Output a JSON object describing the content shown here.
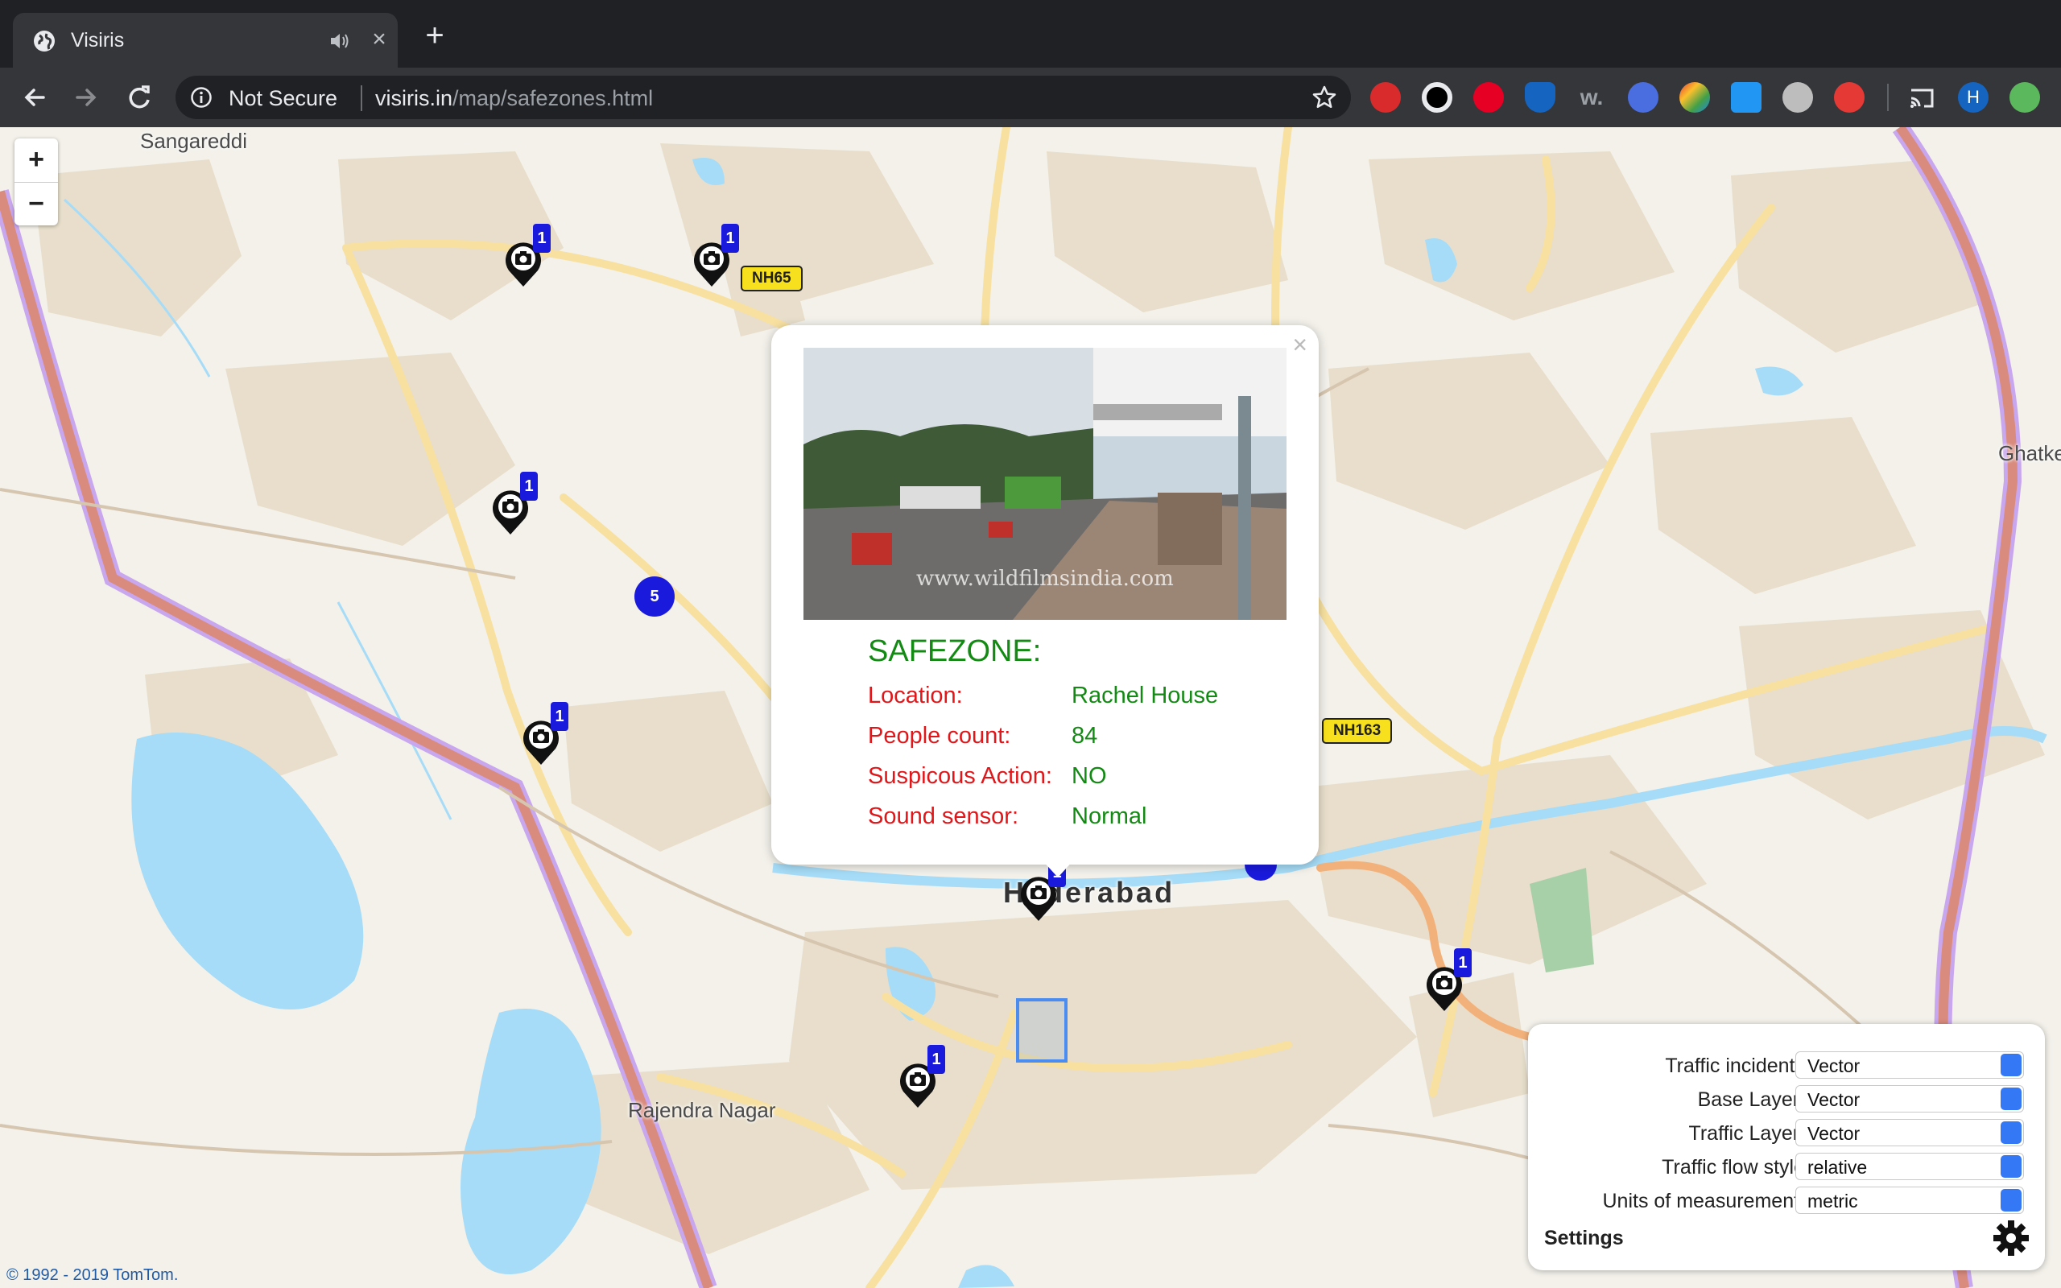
{
  "browser": {
    "tab_title": "Visiris",
    "tab_close": "×",
    "new_tab": "+",
    "security_label": "Not Secure",
    "url_host": "visiris.in",
    "url_path": "/map/safezones.html",
    "profile_initial": "H"
  },
  "map": {
    "zoom_in": "+",
    "zoom_out": "−",
    "places": {
      "sangareddi": "Sangareddi",
      "ghatkesar": "Ghatke",
      "hyderabad": "Hyderabad",
      "rajendra_nagar": "Rajendra Nagar"
    },
    "shields": {
      "nh65": "NH65",
      "nh163": "NH163"
    },
    "marker_badge": "1",
    "cluster_count": "5",
    "copyright": "© 1992 - 2019 TomTom."
  },
  "popup": {
    "close": "×",
    "watermark": "www.wildfilmsindia.com",
    "heading": "SAFEZONE:",
    "fields": [
      {
        "key": "Location:",
        "value": "Rachel House"
      },
      {
        "key": "People count:",
        "value": "84"
      },
      {
        "key": "Suspicous Action:",
        "value": "NO"
      },
      {
        "key": "Sound sensor:",
        "value": "Normal"
      }
    ]
  },
  "settings": {
    "title": "Settings",
    "rows": [
      {
        "label": "Traffic incidents",
        "value": "Vector"
      },
      {
        "label": "Base Layer:",
        "value": "Vector"
      },
      {
        "label": "Traffic Layer:",
        "value": "Vector"
      },
      {
        "label": "Traffic flow style",
        "value": "relative"
      },
      {
        "label": "Units of measurement:",
        "value": "metric"
      }
    ]
  },
  "colors": {
    "popup_key": "#e0171a",
    "popup_value": "#138a13",
    "cluster": "#1a1adc",
    "water": "#a6dcf7",
    "urban": "#e8decb"
  }
}
